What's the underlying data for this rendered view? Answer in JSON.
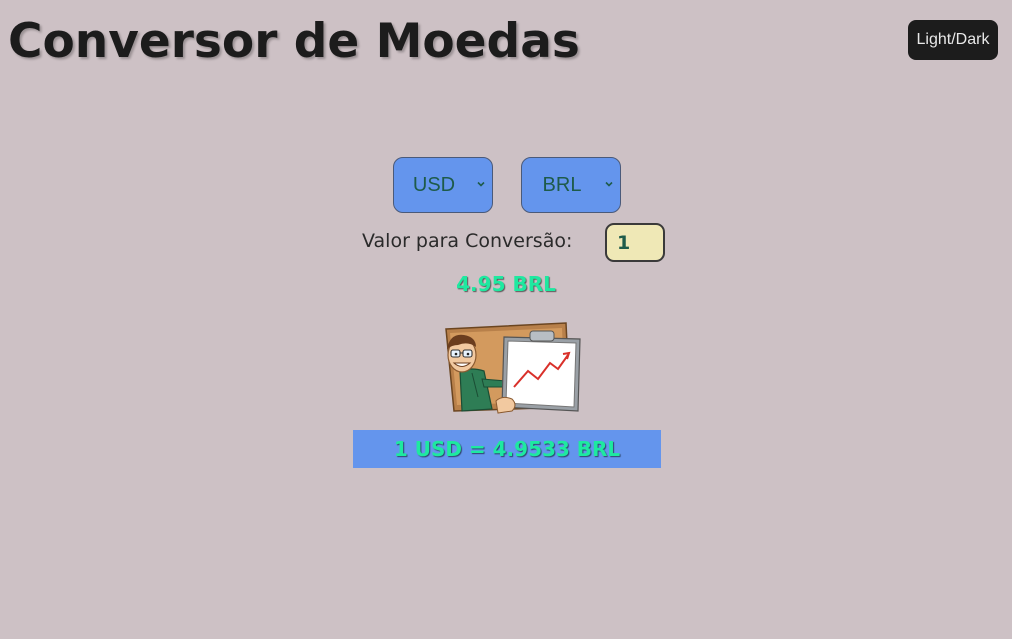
{
  "header": {
    "title": "Conversor de Moedas",
    "theme_button": "Light/Dark"
  },
  "converter": {
    "from_currency": "USD",
    "to_currency": "BRL",
    "amount_label": "Valor para Conversão:",
    "amount_value": "1",
    "result": "4.95 BRL",
    "rate_text": "1 USD = 4.9533 BRL"
  },
  "icons": {
    "select_arrow": "chevron-down-icon",
    "illustration": "chart-presenter-illustration"
  },
  "colors": {
    "background": "#cdc1c5",
    "accent": "#6495ed",
    "result_text": "#1ee9a0",
    "input_bg": "#efe8b6",
    "button_bg": "#1c1c1c"
  }
}
